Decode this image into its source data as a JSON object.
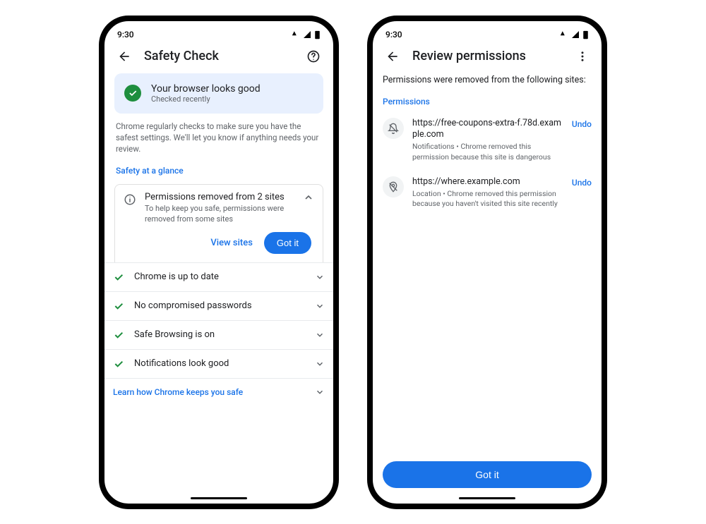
{
  "statusbar": {
    "time": "9:30"
  },
  "left": {
    "title": "Safety Check",
    "status": {
      "title": "Your browser looks good",
      "sub": "Checked recently"
    },
    "description": "Chrome regularly checks to make sure you have the safest settings. We'll let you know if anything needs your review.",
    "glance_link": "Safety at a glance",
    "perm_card": {
      "title": "Permissions removed from 2 sites",
      "sub": "To help keep you safe, permissions were removed from some sites",
      "view_sites": "View sites",
      "got_it": "Got it"
    },
    "items": [
      "Chrome is up to date",
      "No compromised passwords",
      "Safe Browsing is on",
      "Notifications look good"
    ],
    "learn_more": "Learn how Chrome keeps you safe"
  },
  "right": {
    "title": "Review permissions",
    "description": "Permissions were removed from the following sites:",
    "section_label": "Permissions",
    "sites": [
      {
        "url": "https://free-coupons-extra-f.78d.example.com",
        "sub": "Notifications • Chrome removed this permission because this site is dangerous",
        "undo": "Undo"
      },
      {
        "url": "https://where.example.com",
        "sub": "Location • Chrome removed this permission because you haven't visited this site recently",
        "undo": "Undo"
      }
    ],
    "got_it": "Got it"
  }
}
